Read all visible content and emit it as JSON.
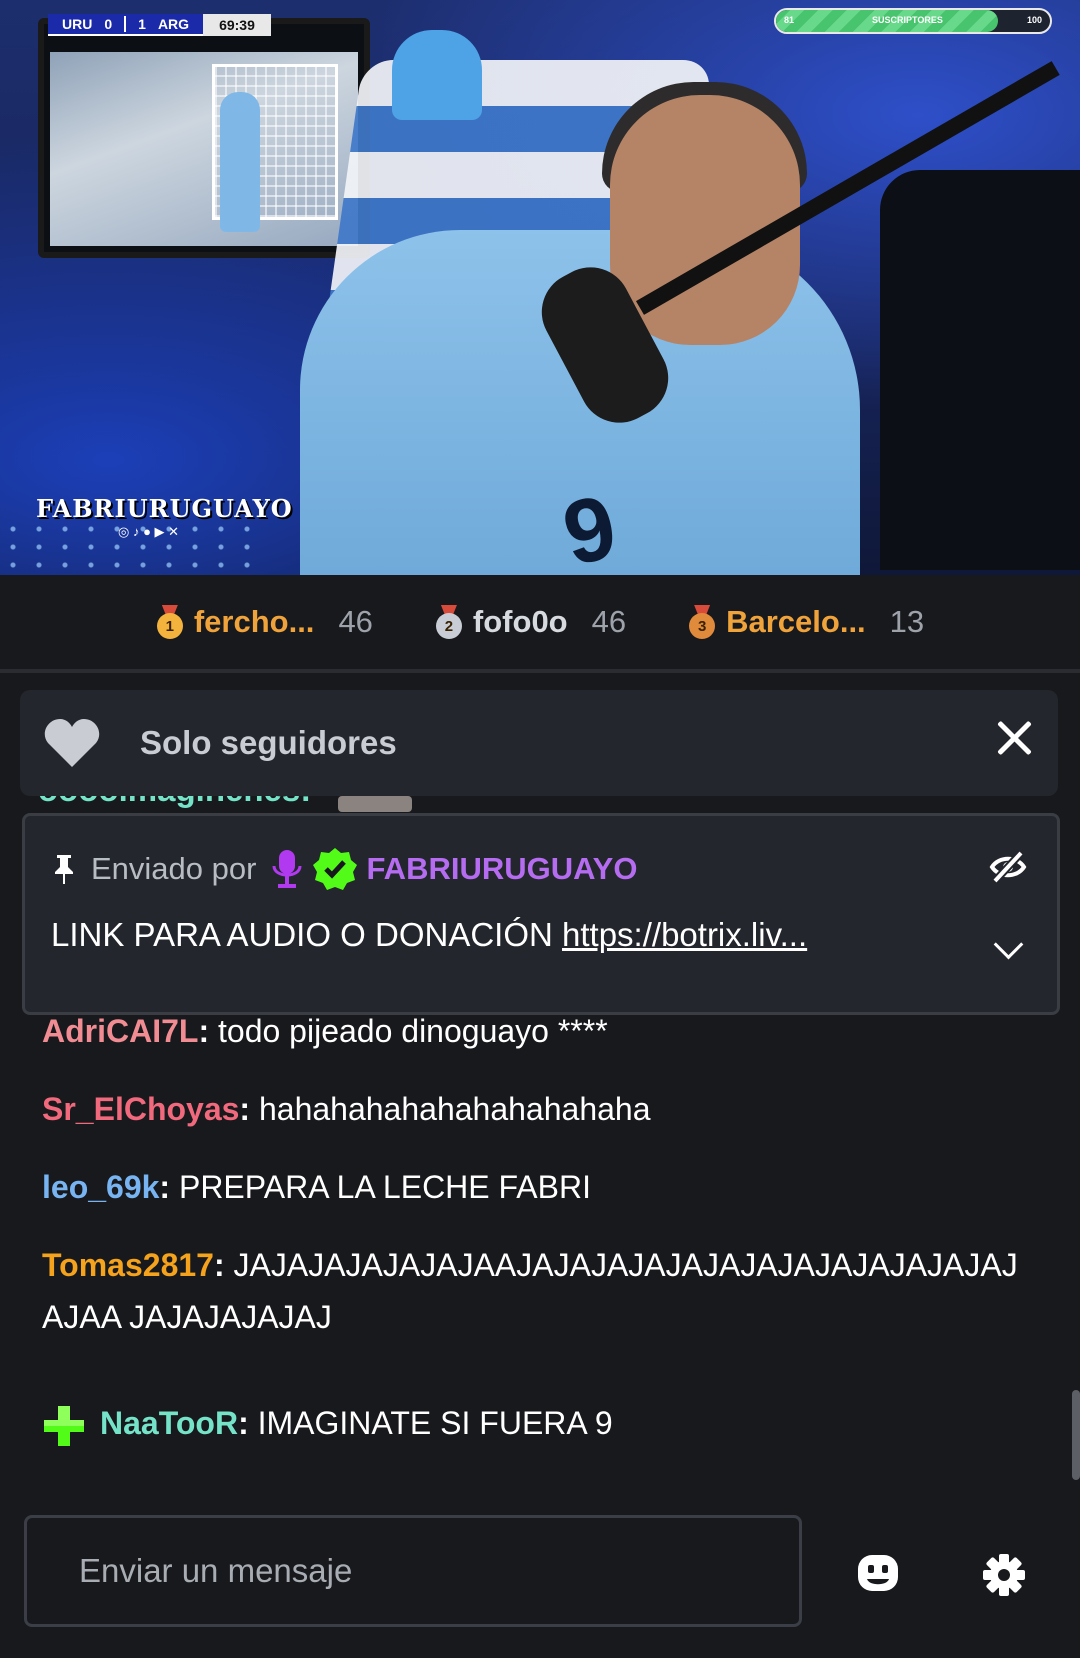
{
  "stream": {
    "scoreboard": {
      "home": "URU",
      "home_score": "0",
      "away_score": "1",
      "away": "ARG",
      "clock": "69:39"
    },
    "subscriber_goal": {
      "current": "81",
      "label": "SUSCRIPTORES",
      "target": "100",
      "progress": 0.81
    },
    "brand": "FABRIURUGUAYO",
    "jersey_number": "9"
  },
  "leaderboard": [
    {
      "rank": "1",
      "name": "fercho...",
      "score": "46",
      "color": "#f0a33a"
    },
    {
      "rank": "2",
      "name": "fofo0o",
      "score": "46",
      "color": "#d7dbe0"
    },
    {
      "rank": "3",
      "name": "Barcelo...",
      "score": "13",
      "color": "#f0a33a"
    }
  ],
  "followers_only": {
    "label": "Solo seguidores"
  },
  "hidden_message": {
    "text": "ooooimaginenes:"
  },
  "pinned": {
    "sent_by_label": "Enviado por",
    "author": "FABRIURUGUAYO",
    "text": "LINK PARA AUDIO O DONACIÓN ",
    "link": "https://botrix.liv..."
  },
  "messages": [
    {
      "user": "AdriCAI7L",
      "color": "#f08c92",
      "text": " todo pijeado dinoguayo ****"
    },
    {
      "user": "Sr_ElChoyas",
      "color": "#f0697c",
      "text": " hahahahahahahahahahaha"
    },
    {
      "user": "leo_69k",
      "color": "#78b4f2",
      "text": " PREPARA LA LECHE FABRI"
    },
    {
      "user": "Tomas2817",
      "color": "#f5a21c",
      "text": " JAJAJAJAJAJAJAAJAJAJAJAJAJAJAJAJAJAJAJAJAJAJAA JAJAJAJAJAJ"
    },
    {
      "user": "NaaTooR",
      "color": "#74e3c8",
      "text": " IMAGINATE SI FUERA 9"
    }
  ],
  "composer": {
    "placeholder": "Enviar un mensaje"
  },
  "colors": {
    "accent_green": "#53fc18",
    "mod_purple": "#b56cf0",
    "background": "#18191d"
  }
}
